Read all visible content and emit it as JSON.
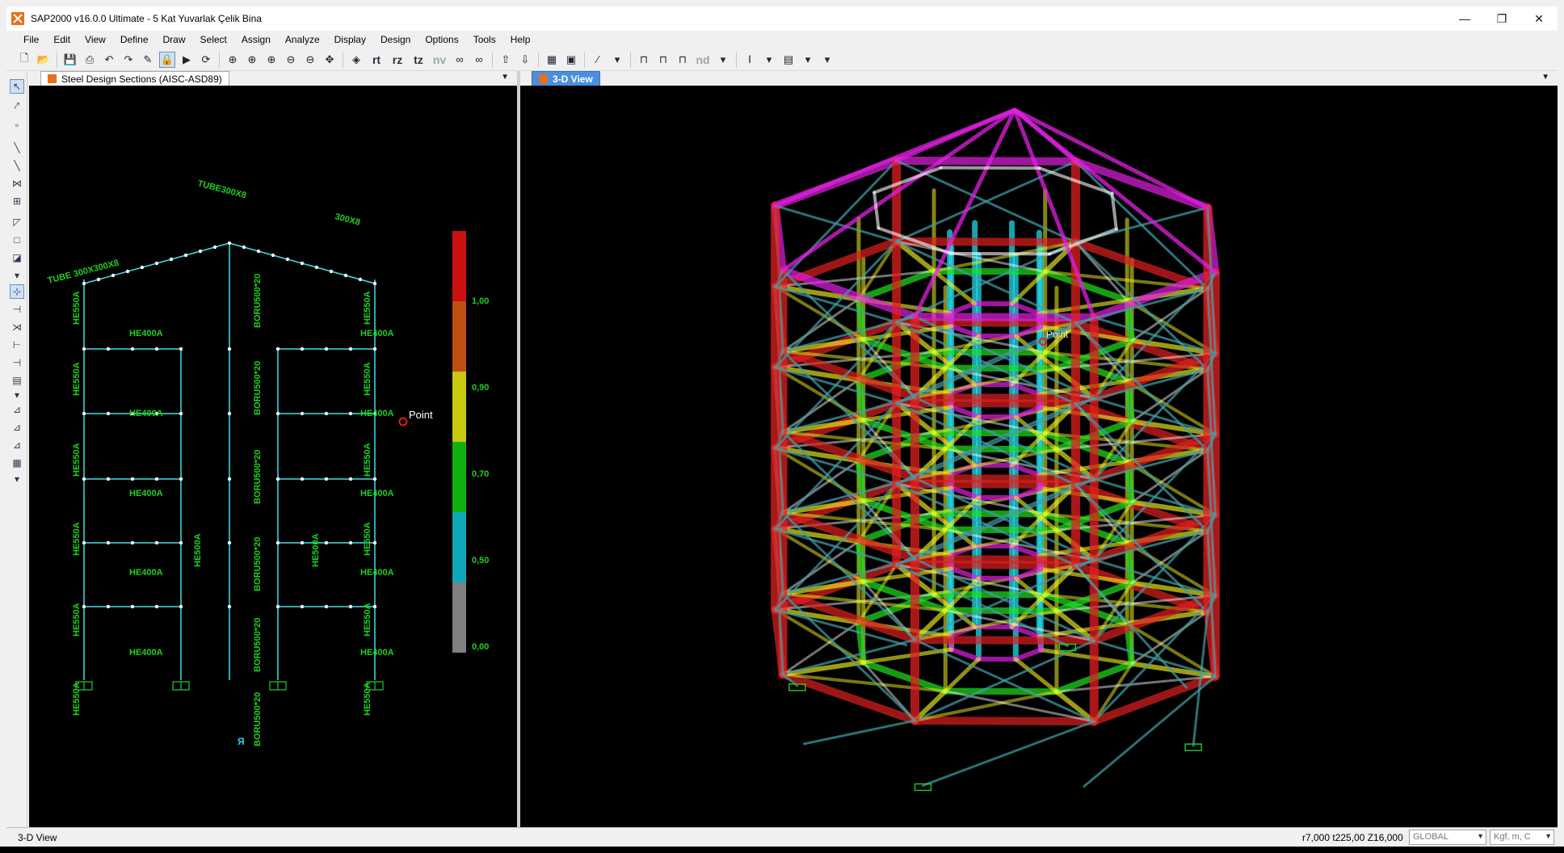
{
  "window": {
    "title": "SAP2000 v16.0.0 Ultimate  - 5 Kat Yuvarlak Çelik Bina",
    "controls": [
      "—",
      "❐",
      "✕"
    ]
  },
  "menu": [
    "File",
    "Edit",
    "View",
    "Define",
    "Draw",
    "Select",
    "Assign",
    "Analyze",
    "Display",
    "Design",
    "Options",
    "Tools",
    "Help"
  ],
  "toolbar": {
    "text_buttons": [
      "rt",
      "rz",
      "tz",
      "nv"
    ],
    "nd_label": "nd"
  },
  "left_pane": {
    "tab_label": "Steel Design Sections  (AISC-ASD89)",
    "point_label": "Point",
    "frame_labels": {
      "column_outer": "HE550A",
      "beam": "HE400A",
      "column_inner": "HE500A",
      "pipe": "BORU500*20",
      "tube_left": "TUBE 300X300X8",
      "tube_top": "TUBE300X8",
      "tube_right": "300X8"
    },
    "legend": {
      "values": [
        "1,00",
        "0,90",
        "0,70",
        "0,50",
        "0,00"
      ],
      "colors": [
        "#cc1010",
        "#c05010",
        "#c8c810",
        "#10b010",
        "#10a8b8",
        "#808080"
      ]
    }
  },
  "right_pane": {
    "tab_label": "3-D View",
    "point_label": "Point"
  },
  "status": {
    "view_label": "3-D View",
    "coords": "r7,000  t225,00  Z16,000",
    "coord_system": "GLOBAL",
    "units": "Kgf, m, C"
  },
  "colors": {
    "frame_red": "#e02020",
    "frame_yellow": "#f0f020",
    "frame_green": "#20e020",
    "frame_cyan": "#20d8e8",
    "frame_magenta": "#e020e0",
    "elevation_lines": "#40e0e8",
    "label_green": "#20d020"
  }
}
